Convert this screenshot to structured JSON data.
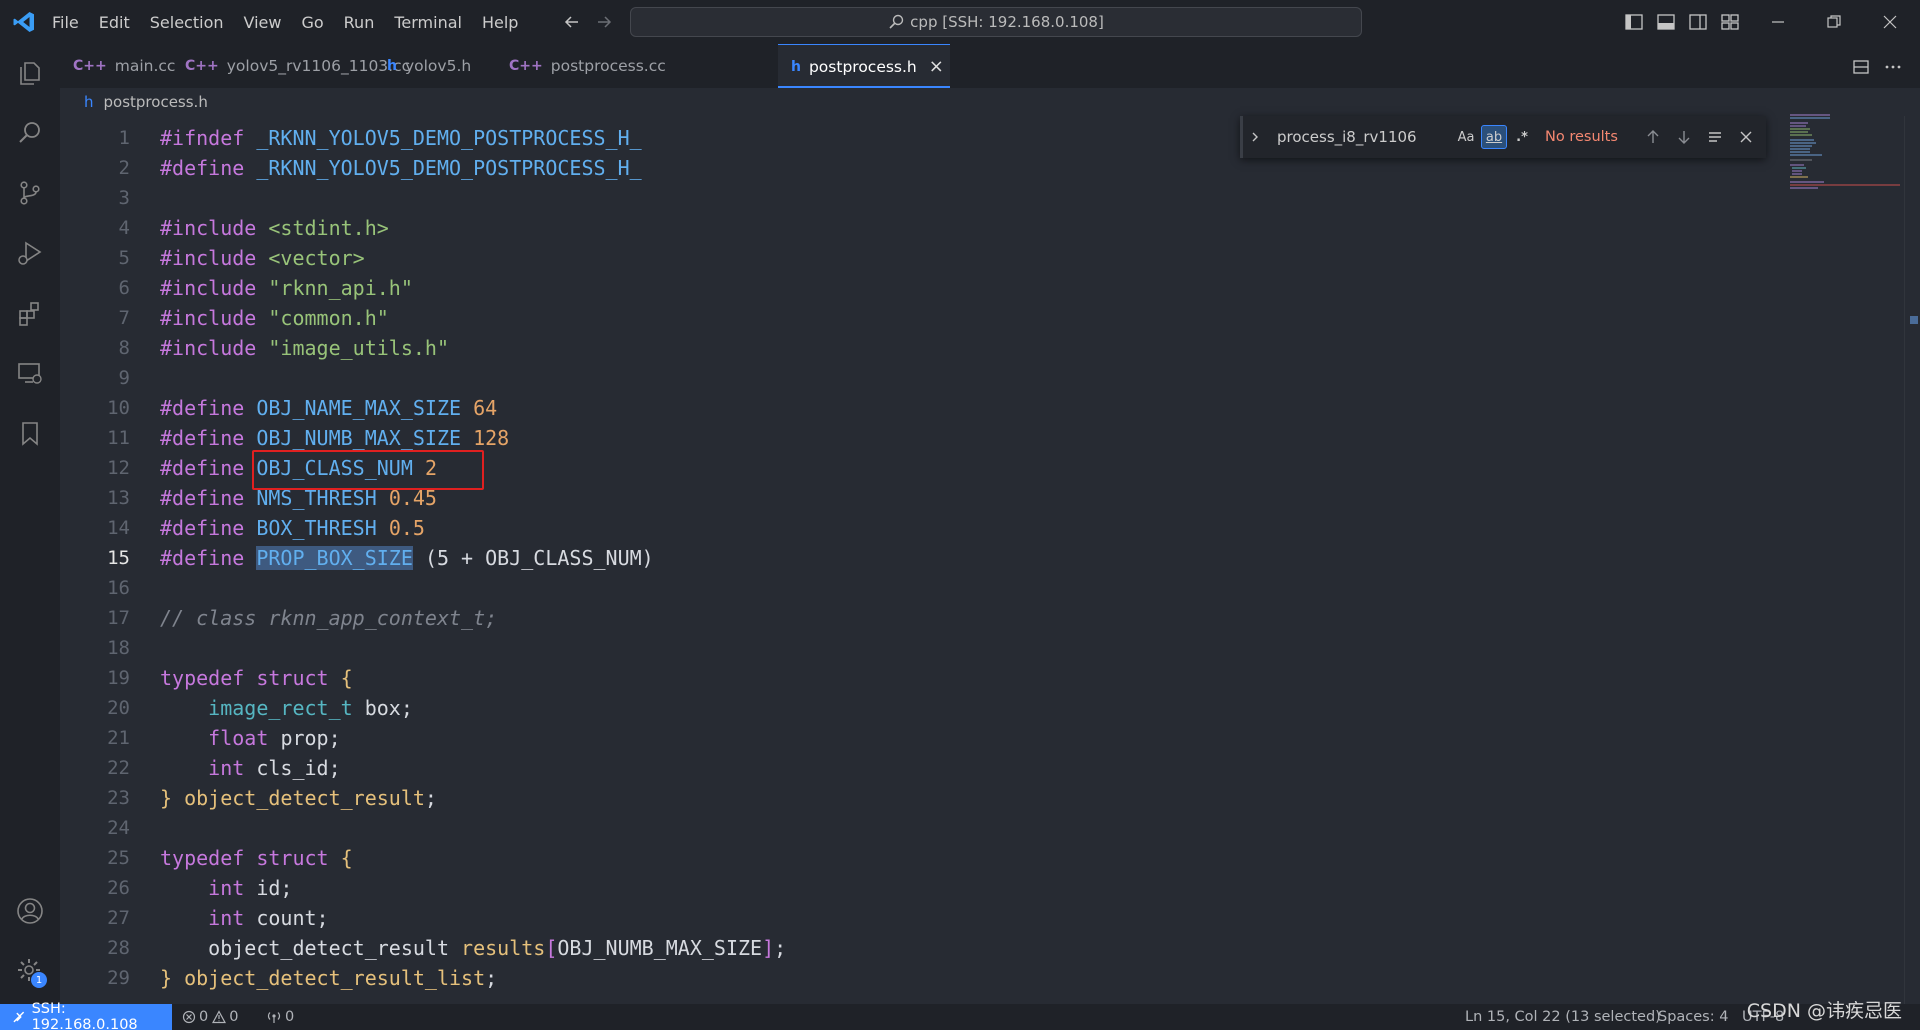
{
  "menu": [
    "File",
    "Edit",
    "Selection",
    "View",
    "Go",
    "Run",
    "Terminal",
    "Help"
  ],
  "command_center": {
    "text": "cpp [SSH: 192.168.0.108]"
  },
  "tabs": [
    {
      "icon": "C++",
      "label": "main.cc"
    },
    {
      "icon": "C++",
      "label": "yolov5_rv1106_1103.cc"
    },
    {
      "icon": "h",
      "label": "yolov5.h"
    },
    {
      "icon": "C++",
      "label": "postprocess.cc"
    },
    {
      "icon": "h",
      "label": "postprocess.h",
      "close": "×"
    }
  ],
  "breadcrumb": {
    "icon": "h",
    "file": "postprocess.h"
  },
  "find": {
    "query": "process_i8_rv1106",
    "match_case": "Aa",
    "whole_word": "ab",
    "regex": ".*",
    "status": "No results"
  },
  "editor": {
    "line_numbers": [
      "1",
      "2",
      "3",
      "4",
      "5",
      "6",
      "7",
      "8",
      "9",
      "10",
      "11",
      "12",
      "13",
      "14",
      "15",
      "16",
      "17",
      "18",
      "19",
      "20",
      "21",
      "22",
      "23",
      "24",
      "25",
      "26",
      "27",
      "28",
      "29"
    ],
    "active_line": "15",
    "lines": {
      "l1a": "#ifndef",
      "l1b": "_RKNN_YOLOV5_DEMO_POSTPROCESS_H_",
      "l2a": "#define",
      "l2b": "_RKNN_YOLOV5_DEMO_POSTPROCESS_H_",
      "l4a": "#include",
      "l4b": "<stdint.h>",
      "l5a": "#include",
      "l5b": "<vector>",
      "l6a": "#include",
      "l6b": "\"rknn_api.h\"",
      "l7a": "#include",
      "l7b": "\"common.h\"",
      "l8a": "#include",
      "l8b": "\"image_utils.h\"",
      "l10a": "#define",
      "l10b": "OBJ_NAME_MAX_SIZE",
      "l10c": "64",
      "l11a": "#define",
      "l11b": "OBJ_NUMB_MAX_SIZE",
      "l11c": "128",
      "l12a": "#define",
      "l12b": "OBJ_CLASS_NUM",
      "l12c": "2",
      "l13a": "#define",
      "l13b": "NMS_THRESH",
      "l13c": "0.45",
      "l14a": "#define",
      "l14b": "BOX_THRESH",
      "l14c": "0.5",
      "l15a": "#define",
      "l15b": "PROP_BOX_SIZE",
      "l15c": "(5 + OBJ_CLASS_NUM)",
      "l17": "// class rknn_app_context_t;",
      "l19a": "typedef",
      "l19b": "struct",
      "l19c": "{",
      "l20a": "image_rect_t",
      "l20b": "box;",
      "l21a": "float",
      "l21b": "prop;",
      "l22a": "int",
      "l22b": "cls_id;",
      "l23a": "}",
      "l23b": "object_detect_result",
      "l25a": "typedef",
      "l25b": "struct",
      "l25c": "{",
      "l26a": "int",
      "l26b": "id;",
      "l27a": "int",
      "l27b": "count;",
      "l28a": "object_detect_result",
      "l28b": "results",
      "l28c": "[",
      "l28d": "OBJ_NUMB_MAX_SIZE",
      "l28e": "]",
      "l29a": "}",
      "l29b": "object_detect_result_list",
      "semi": ";"
    }
  },
  "statusbar": {
    "remote": "SSH: 192.168.0.108",
    "errors": "0",
    "warnings": "0",
    "ports": "0",
    "cursor": "Ln 15, Col 22 (13 selected)",
    "spaces": "Spaces: 4",
    "encoding": "UTF-8"
  },
  "activity_badge": "1",
  "watermark": "CSDN @讳疾忌医",
  "colors": {
    "accent": "#3a86ff",
    "annotation_box": "#e02020",
    "error_text": "#f48771"
  }
}
